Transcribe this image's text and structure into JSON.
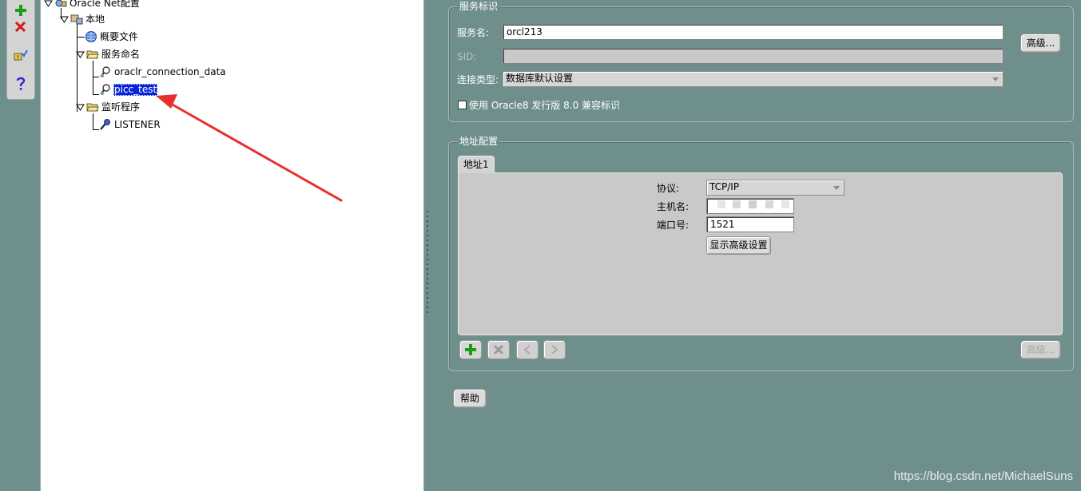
{
  "toolbar": {
    "items": [
      {
        "icon": "add-icon",
        "color": "#1a9e1a"
      },
      {
        "icon": "delete-icon",
        "color": "#d01818"
      },
      {
        "icon": "test-connection-icon"
      },
      {
        "icon": "help-icon",
        "color": "#2a2ad0"
      }
    ]
  },
  "tree": {
    "root": "Oracle Net配置",
    "local": "本地",
    "profile": "概要文件",
    "service_naming": "服务命名",
    "service_1": "oraclr_connection_data",
    "service_2": "picc_test",
    "listeners": "监听程序",
    "listener_1": "LISTENER"
  },
  "service_id": {
    "title": "服务标识",
    "service_name_label": "服务名:",
    "service_name_value": "orcl213",
    "sid_label": "SID:",
    "sid_value": "",
    "connection_type_label": "连接类型:",
    "connection_type_value": "数据库默认设置",
    "advanced_button": "高级...",
    "oracle8_checkbox": "使用 Oracle8 发行版 8.0 兼容标识",
    "oracle8_checked": false
  },
  "address_config": {
    "title": "地址配置",
    "tab": "地址1",
    "protocol_label": "协议:",
    "protocol_value": "TCP/IP",
    "host_label": "主机名:",
    "host_value": "",
    "port_label": "端口号:",
    "port_value": "1521",
    "show_advanced_button": "显示高级设置",
    "advanced_button": "高级..."
  },
  "help_button": "帮助",
  "watermark": "https://blog.csdn.net/MichaelSuns",
  "colors": {
    "background": "#6f8f8c",
    "selection": "#0a24d8",
    "annotation_arrow": "#e8302a"
  }
}
